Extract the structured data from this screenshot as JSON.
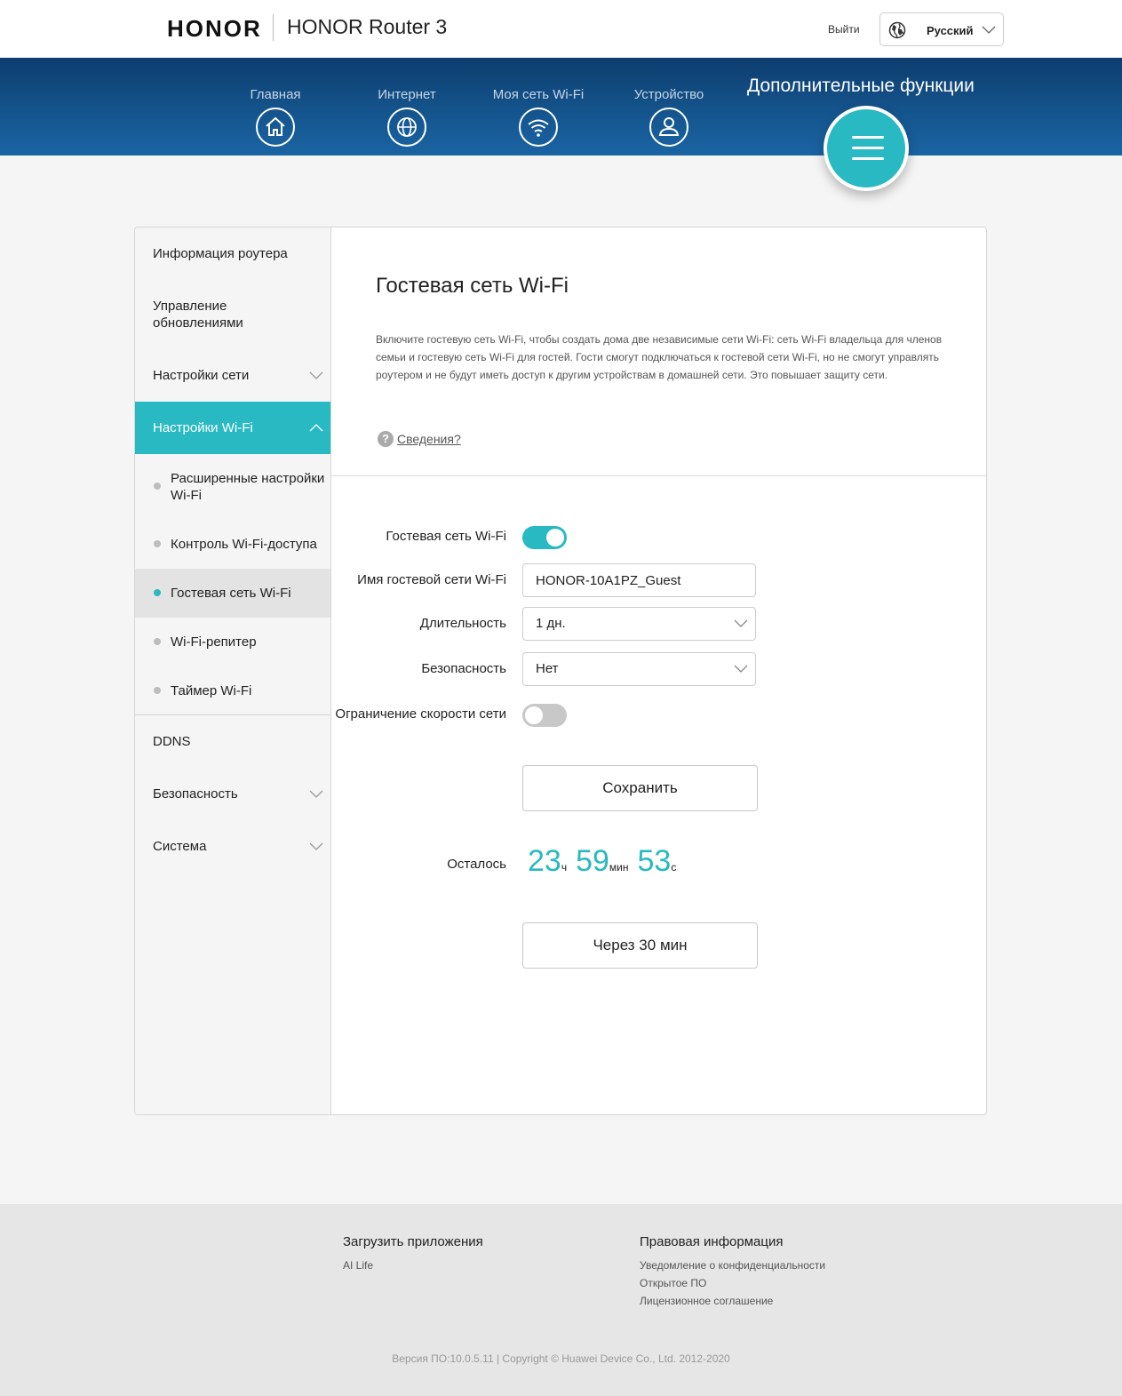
{
  "header": {
    "brand": "HONOR",
    "product": "HONOR Router 3",
    "logout": "Выйти",
    "language": "Русский"
  },
  "nav": {
    "items": [
      {
        "label": "Главная",
        "icon": "home-icon"
      },
      {
        "label": "Интернет",
        "icon": "globe-icon"
      },
      {
        "label": "Моя сеть Wi-Fi",
        "icon": "wifi-icon"
      },
      {
        "label": "Устройство",
        "icon": "user-icon"
      }
    ],
    "active": {
      "label": "Дополнительные функции",
      "icon": "menu-icon"
    }
  },
  "sidebar": {
    "items": [
      {
        "label": "Информация роутера"
      },
      {
        "label": "Управление обновлениями"
      },
      {
        "label": "Настройки сети"
      },
      {
        "label": "Настройки Wi-Fi"
      },
      {
        "label": "DDNS"
      },
      {
        "label": "Безопасность"
      },
      {
        "label": "Система"
      }
    ],
    "wifi_sub": [
      {
        "label": "Расширенные настройки Wi-Fi"
      },
      {
        "label": "Контроль Wi-Fi-доступа"
      },
      {
        "label": "Гостевая сеть Wi-Fi"
      },
      {
        "label": "Wi-Fi-репитер"
      },
      {
        "label": "Таймер Wi-Fi"
      }
    ]
  },
  "content": {
    "title": "Гостевая сеть Wi-Fi",
    "description": "Включите гостевую сеть Wi-Fi, чтобы создать дома две независимые сети Wi-Fi: сеть Wi-Fi владельца для членов семьи и гостевую сеть Wi-Fi для гостей. Гости смогут подключаться к гостевой сети Wi-Fi, но не смогут управлять роутером и не будут иметь доступ к другим устройствам в домашней сети. Это повышает защиту сети.",
    "help_icon": "?",
    "help_link": "Сведения?"
  },
  "form": {
    "guest_wifi_label": "Гостевая сеть Wi-Fi",
    "guest_wifi_enabled": true,
    "ssid_label": "Имя гостевой сети Wi-Fi",
    "ssid_value": "HONOR-10A1PZ_Guest",
    "duration_label": "Длительность",
    "duration_value": "1 дн.",
    "security_label": "Безопасность",
    "security_value": "Нет",
    "speed_limit_label": "Ограничение скорости сети",
    "speed_limit_enabled": false,
    "save_button": "Сохранить"
  },
  "timer": {
    "label": "Осталось",
    "hours": "23",
    "hours_unit": "ч",
    "minutes": "59",
    "minutes_unit": "мин",
    "seconds": "53",
    "seconds_unit": "с",
    "extend_button": "Через 30 мин"
  },
  "footer": {
    "apps_title": "Загрузить приложения",
    "apps_links": [
      "AI Life"
    ],
    "legal_title": "Правовая информация",
    "legal_links": [
      "Уведомление о конфиденциальности",
      "Открытое ПО",
      "Лицензионное соглашение"
    ],
    "copyright": "Версия ПО:10.0.5.11 |  Copyright © Huawei Device Co., Ltd. 2012-2020"
  },
  "colors": {
    "accent": "#29b9c2",
    "nav_dark": "#0d3d6e",
    "nav_light": "#1a64a3"
  }
}
